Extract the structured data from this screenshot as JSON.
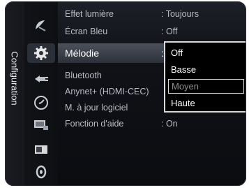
{
  "side_tab": {
    "label": "Configuration"
  },
  "icons": [
    "satellite-icon",
    "settings-gear-icon",
    "input-plug-icon",
    "support-clock-icon",
    "tv-screen-icon",
    "picture-icon",
    "power-icon"
  ],
  "menu": {
    "items": [
      {
        "label": "Effet lumière",
        "value": ": Toujours"
      },
      {
        "label": "Écran Bleu",
        "value": ": Off"
      },
      {
        "label": "Mélodie",
        "value": ":"
      },
      {
        "label": "Bluetooth",
        "value": ""
      },
      {
        "label": "Anynet+ (HDMI-CEC)",
        "value": ""
      },
      {
        "label": "M. à jour logiciel",
        "value": ""
      },
      {
        "label": "Fonction d'aide",
        "value": ": On"
      }
    ],
    "selected": "Mélodie"
  },
  "dropdown": {
    "options": [
      "Off",
      "Basse",
      "Moyen",
      "Haute"
    ],
    "highlighted": "Moyen"
  }
}
